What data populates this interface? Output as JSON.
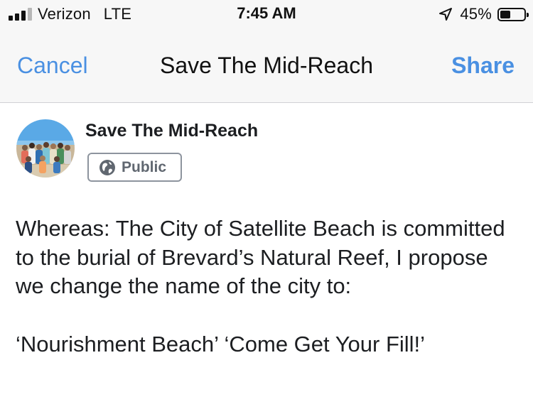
{
  "status_bar": {
    "carrier": "Verizon",
    "network": "LTE",
    "time": "7:45 AM",
    "battery_percent": "45%",
    "battery_level": 0.45,
    "signal_bars": 3,
    "signal_bars_total": 4,
    "icons": [
      "signal-icon",
      "location-arrow-icon",
      "battery-icon"
    ]
  },
  "nav": {
    "cancel_label": "Cancel",
    "title": "Save The Mid-Reach",
    "share_label": "Share"
  },
  "author": {
    "name": "Save The Mid-Reach",
    "audience_label": "Public",
    "audience_icon": "globe-icon"
  },
  "post": {
    "paragraph_1": "Whereas: The City of Satellite Beach is committed to the burial of Brevard’s Natural Reef, I propose we change the name of the city to:",
    "paragraph_2": "‘Nourishment Beach’ ‘Come Get Your Fill!’"
  },
  "colors": {
    "accent": "#4a90e2",
    "bar_background": "#f7f7f7",
    "text": "#1c1e21",
    "muted": "#606770"
  }
}
